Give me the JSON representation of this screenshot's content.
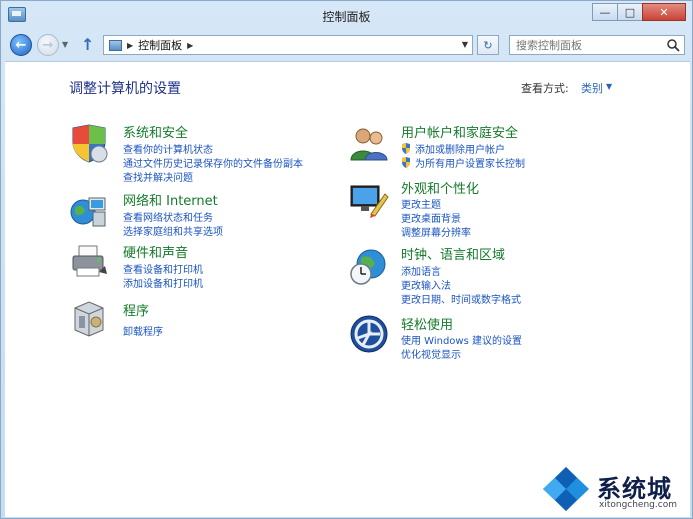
{
  "window": {
    "title": "控制面板"
  },
  "window_controls": {
    "minimize": "—",
    "maximize": "□",
    "close": "✕"
  },
  "navbar": {
    "address_path": "控制面板",
    "search_placeholder": "搜索控制面板"
  },
  "header": {
    "title": "调整计算机的设置",
    "view_by_label": "查看方式:",
    "view_by_value": "类别"
  },
  "categories": [
    {
      "icon": "security-shield-icon",
      "title": "系统和安全",
      "links": [
        "查看你的计算机状态",
        "通过文件历史记录保存你的文件备份副本",
        "查找并解决问题"
      ]
    },
    {
      "icon": "network-globe-icon",
      "title": "网络和 Internet",
      "links": [
        "查看网络状态和任务",
        "选择家庭组和共享选项"
      ]
    },
    {
      "icon": "printer-icon",
      "title": "硬件和声音",
      "links": [
        "查看设备和打印机",
        "添加设备和打印机"
      ]
    },
    {
      "icon": "programs-box-icon",
      "title": "程序",
      "links": [
        "卸载程序"
      ]
    },
    {
      "icon": "users-icon",
      "title": "用户帐户和家庭安全",
      "links": [
        "添加或删除用户帐户",
        "为所有用户设置家长控制"
      ]
    },
    {
      "icon": "appearance-icon",
      "title": "外观和个性化",
      "links": [
        "更改主题",
        "更改桌面背景",
        "调整屏幕分辨率"
      ]
    },
    {
      "icon": "clock-globe-icon",
      "title": "时钟、语言和区域",
      "links": [
        "添加语言",
        "更改输入法",
        "更改日期、时间或数字格式"
      ]
    },
    {
      "icon": "ease-of-access-icon",
      "title": "轻松使用",
      "links": [
        "使用 Windows 建议的设置",
        "优化视觉显示"
      ]
    }
  ],
  "watermark": {
    "name": "系统城",
    "url": "xitongcheng.com"
  }
}
